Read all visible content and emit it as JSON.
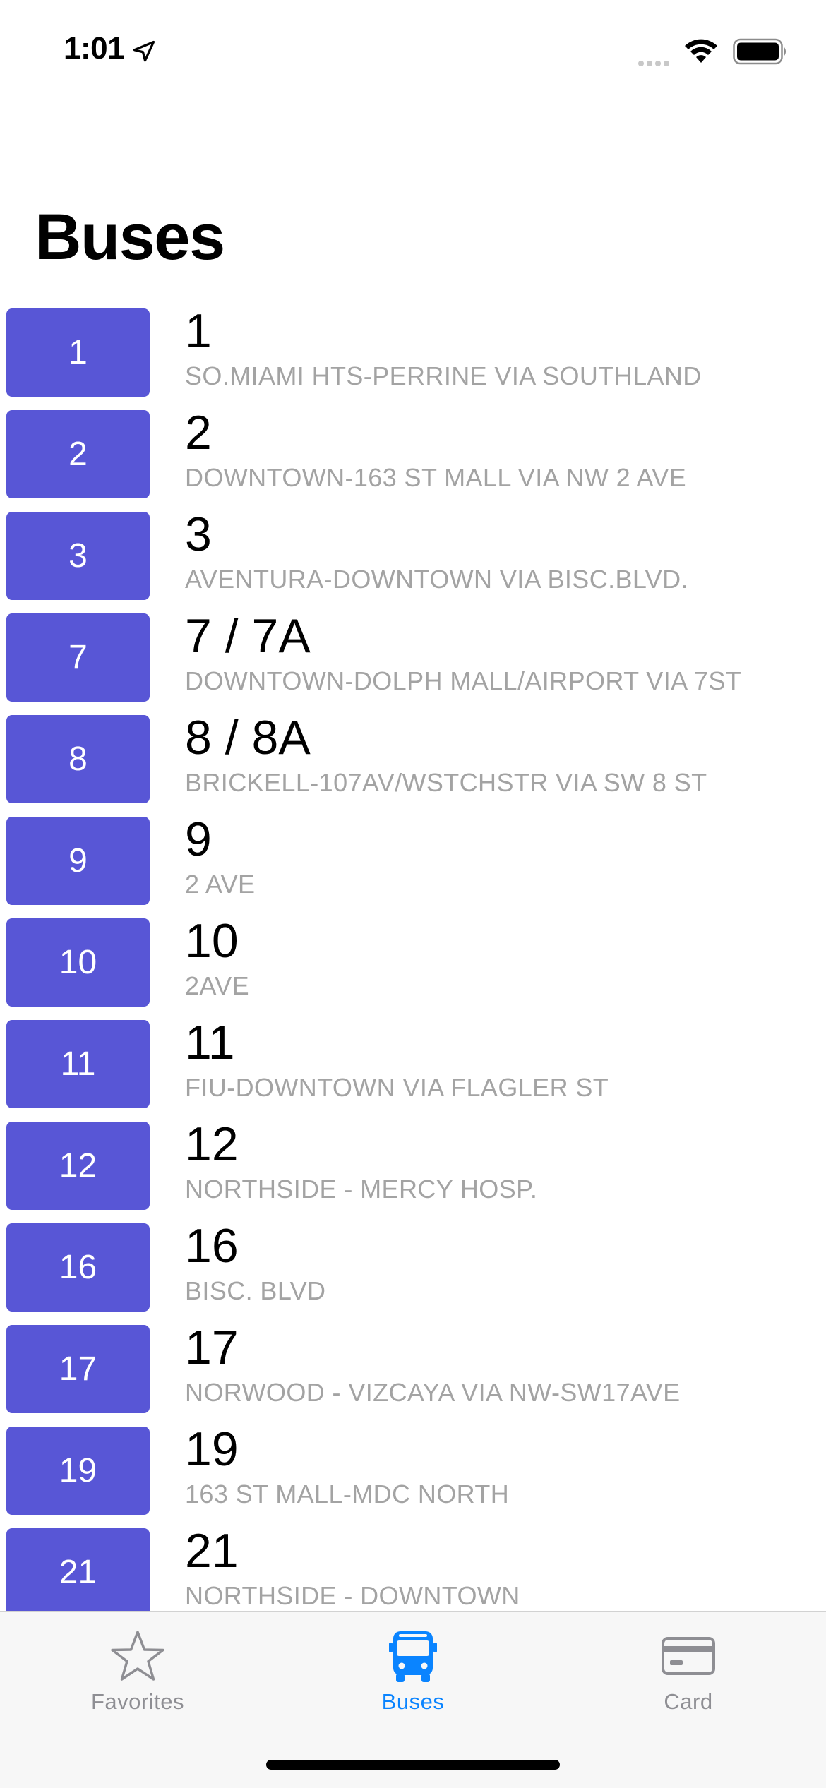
{
  "status_bar": {
    "time": "1:01"
  },
  "page_title": "Buses",
  "routes": [
    {
      "badge": "1",
      "name": "1",
      "description": "SO.MIAMI HTS-PERRINE VIA SOUTHLAND"
    },
    {
      "badge": "2",
      "name": "2",
      "description": "DOWNTOWN-163 ST MALL VIA NW 2 AVE"
    },
    {
      "badge": "3",
      "name": "3",
      "description": "AVENTURA-DOWNTOWN VIA BISC.BLVD."
    },
    {
      "badge": "7",
      "name": "7 / 7A",
      "description": "DOWNTOWN-DOLPH MALL/AIRPORT VIA 7ST"
    },
    {
      "badge": "8",
      "name": "8 / 8A",
      "description": "BRICKELL-107AV/WSTCHSTR VIA SW 8 ST"
    },
    {
      "badge": "9",
      "name": "9",
      "description": "2 AVE"
    },
    {
      "badge": "10",
      "name": "10",
      "description": "2AVE"
    },
    {
      "badge": "11",
      "name": "11",
      "description": "FIU-DOWNTOWN VIA FLAGLER ST"
    },
    {
      "badge": "12",
      "name": "12",
      "description": "NORTHSIDE - MERCY HOSP."
    },
    {
      "badge": "16",
      "name": "16",
      "description": "BISC. BLVD"
    },
    {
      "badge": "17",
      "name": "17",
      "description": "NORWOOD - VIZCAYA VIA NW-SW17AVE"
    },
    {
      "badge": "19",
      "name": "19",
      "description": "163 ST MALL-MDC NORTH"
    },
    {
      "badge": "21",
      "name": "21",
      "description": "NORTHSIDE - DOWNTOWN"
    }
  ],
  "badge_color": "#5856d6",
  "tab_bar": {
    "tabs": [
      {
        "label": "Favorites",
        "icon": "star-icon",
        "active": false
      },
      {
        "label": "Buses",
        "icon": "bus-icon",
        "active": true
      },
      {
        "label": "Card",
        "icon": "card-icon",
        "active": false
      }
    ],
    "active_color": "#0a84ff",
    "inactive_color": "#8e8e93"
  }
}
